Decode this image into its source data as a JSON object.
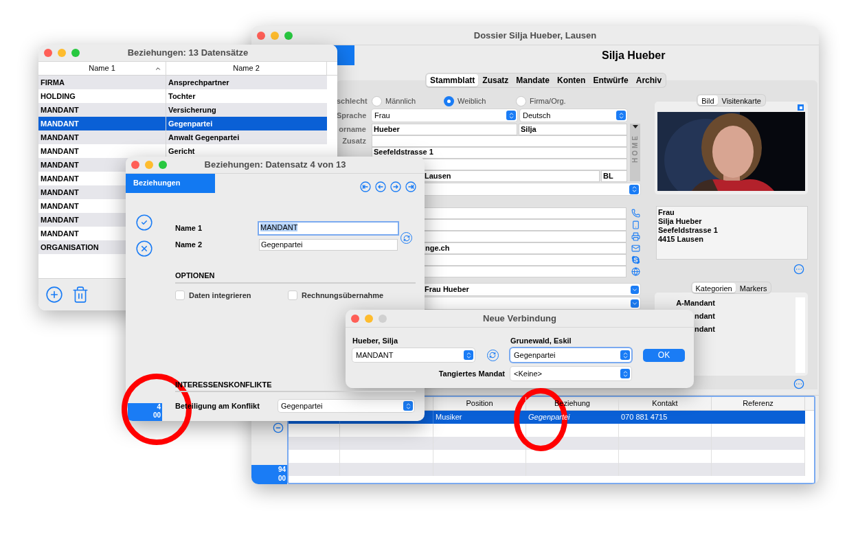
{
  "relations_list": {
    "title": "Beziehungen: 13 Datensätze",
    "zoom_enabled": true,
    "columns": [
      {
        "label": "Name 1",
        "sorted": true
      },
      {
        "label": "Name 2",
        "sorted": false
      }
    ],
    "rows": [
      {
        "name1": "FIRMA",
        "name2": "Ansprechpartner",
        "selected": false
      },
      {
        "name1": "HOLDING",
        "name2": "Tochter",
        "selected": false
      },
      {
        "name1": "MANDANT",
        "name2": "Versicherung",
        "selected": false
      },
      {
        "name1": "MANDANT",
        "name2": "Gegenpartei",
        "selected": true
      },
      {
        "name1": "MANDANT",
        "name2": "Anwalt Gegenpartei",
        "selected": false
      },
      {
        "name1": "MANDANT",
        "name2": "Gericht",
        "selected": false
      },
      {
        "name1": "MANDANT",
        "selected": false
      },
      {
        "name1": "MANDANT",
        "selected": false
      },
      {
        "name1": "MANDANT",
        "selected": false
      },
      {
        "name1": "MANDANT",
        "selected": false
      },
      {
        "name1": "MANDANT",
        "selected": false
      },
      {
        "name1": "MANDANT",
        "selected": false
      },
      {
        "name1": "ORGANISATION",
        "selected": false
      }
    ]
  },
  "dossier_window": {
    "title": "Dossier Silja Hueber, Lausen",
    "zoom_enabled": true,
    "heading": "Silja Hueber",
    "tabs": [
      {
        "label": "Stammblatt",
        "selected": true
      },
      {
        "label": "Zusatz",
        "selected": false
      },
      {
        "label": "Mandate",
        "selected": false
      },
      {
        "label": "Konten",
        "selected": false
      },
      {
        "label": "Entwürfe",
        "selected": false
      },
      {
        "label": "Archiv",
        "selected": false
      }
    ],
    "gender": {
      "label": "schlecht",
      "options": [
        {
          "label": "Männlich",
          "selected": false
        },
        {
          "label": "Weiblich",
          "selected": true
        },
        {
          "label": "Firma/Org.",
          "selected": false
        }
      ]
    },
    "salutation": {
      "label": "Sprache",
      "value": "Frau",
      "language": "Deutsch"
    },
    "name": {
      "label": "orname",
      "last_name": "Hueber",
      "first_name": "Silja"
    },
    "addition": {
      "label": "Zusatz"
    },
    "street": "Seefeldstrasse 1",
    "city": "Lausen",
    "canton": "BL",
    "address_type": "HOME",
    "contacts": [
      {
        "kind": "phone"
      },
      {
        "kind": "mobile"
      },
      {
        "kind": "fax"
      },
      {
        "kind": "email",
        "value": "nge.ch"
      },
      {
        "kind": "skype"
      },
      {
        "kind": "web"
      }
    ],
    "letter_salutation": "Frau Hueber",
    "image_tabs": [
      {
        "label": "Bild",
        "selected": true
      },
      {
        "label": "Visitenkarte",
        "selected": false
      }
    ],
    "address_lines": [
      "Frau",
      "Silja Hueber",
      "Seefeldstrasse 1",
      "4415 Lausen"
    ],
    "category_tabs": [
      {
        "label": "Kategorien",
        "selected": true
      },
      {
        "label": "Markers",
        "selected": false
      }
    ],
    "categories": [
      "A-Mandant",
      "ndant",
      "ndant"
    ],
    "table": {
      "columns": [
        "Position",
        "Beziehung",
        "Kontakt",
        "Referenz"
      ],
      "rows": [
        {
          "selected": true,
          "position": "Musiker",
          "relation": "Gegenpartei",
          "contact": "070 881 4715"
        }
      ]
    },
    "counter": [
      "94",
      "00"
    ]
  },
  "relation_record": {
    "title": "Beziehungen: Datensatz 4 von 13",
    "zoom_enabled": true,
    "tab": "Beziehungen",
    "fields": [
      {
        "label": "Name 1",
        "value": "MANDANT",
        "focused": true
      },
      {
        "label": "Name 2",
        "value": "Gegenpartei",
        "focused": false
      }
    ],
    "options_heading": "OPTIONEN",
    "options": [
      {
        "label": "Daten integrieren",
        "checked": false
      },
      {
        "label": "Rechnungsübernahme",
        "checked": false
      }
    ],
    "conflicts_heading": "INTERESSENSKONFLIKTE",
    "involvement_label": "Beteiligung am Konflikt",
    "involvement": "Gegenpartei",
    "counter": [
      "4",
      "00"
    ]
  },
  "new_connection": {
    "title": "Neue Verbindung",
    "zoom_enabled": false,
    "left_name": "Hueber, Silja",
    "left_role": "MANDANT",
    "right_name": "Grunewald, Eskil",
    "right_role": "Gegenpartei",
    "right_focused": true,
    "ok": "OK",
    "mandate_label": "Tangiertes Mandat",
    "mandate": "<Keine>"
  }
}
